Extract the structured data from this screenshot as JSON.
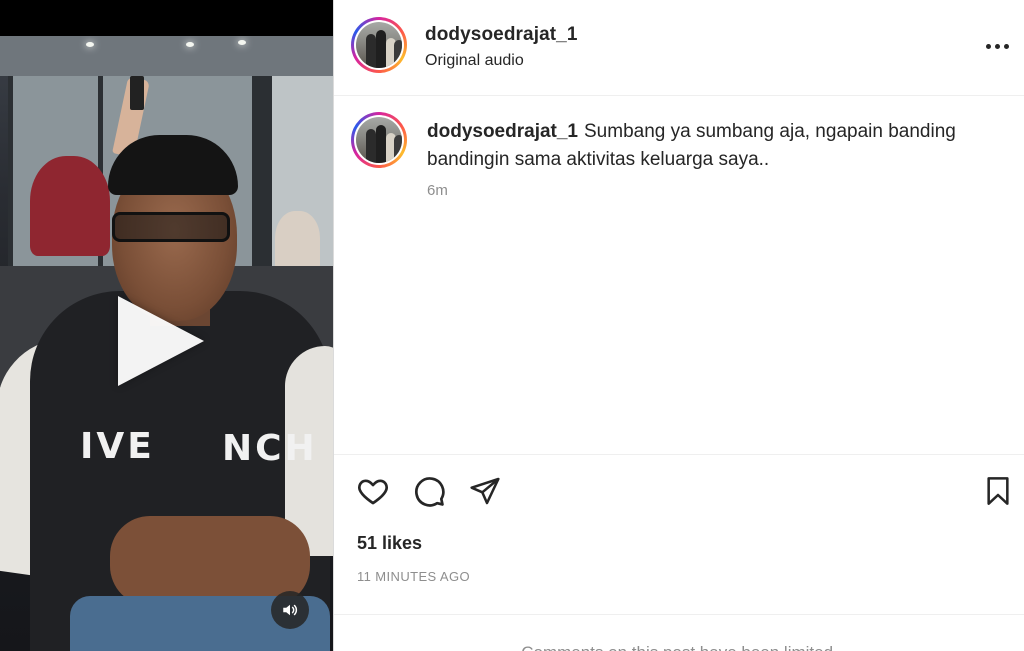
{
  "post": {
    "username": "dodysoedrajat_1",
    "audio_label": "Original audio",
    "caption_user": "dodysoedrajat_1",
    "caption_text": "Sumbang ya sumbang aja, ngapain banding bandingin sama aktivitas keluarga saya..",
    "caption_age": "6m",
    "likes": "51 likes",
    "timestamp": "11 MINUTES AGO",
    "comments_note": "Comments on this post have been limited."
  },
  "video": {
    "jacket_text_left": "IVE",
    "jacket_text_right": "NCH"
  },
  "icons": {
    "more": "more-options-icon",
    "like": "heart-icon",
    "comment": "comment-bubble-icon",
    "share": "paper-plane-icon",
    "save": "bookmark-icon",
    "play": "play-icon",
    "mute": "speaker-icon"
  },
  "colors": {
    "text_primary": "#262626",
    "text_secondary": "#8e8e8e",
    "divider": "#efefef",
    "border": "#dbdbdb"
  }
}
